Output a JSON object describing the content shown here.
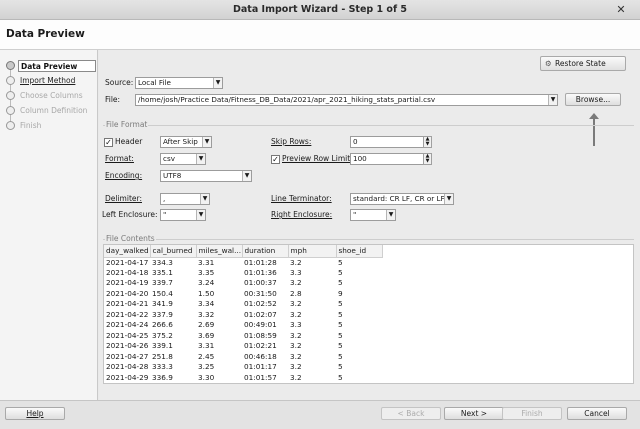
{
  "window": {
    "title": "Data Import Wizard - Step 1 of 5",
    "close_glyph": "✕"
  },
  "header": {
    "title": "Data Preview"
  },
  "steps": [
    {
      "label": "Data Preview",
      "state": "active"
    },
    {
      "label": "Import Method",
      "state": "link"
    },
    {
      "label": "Choose Columns",
      "state": "disabled"
    },
    {
      "label": "Column Definition",
      "state": "disabled"
    },
    {
      "label": "Finish",
      "state": "disabled"
    }
  ],
  "toolbar": {
    "restore_label": "Restore State",
    "restore_icon": "gear-icon"
  },
  "source": {
    "label": "Source:",
    "value": "Local File"
  },
  "file": {
    "label": "File:",
    "path": "/home/josh/Practice Data/Fitness_DB_Data/2021/apr_2021_hiking_stats_partial.csv",
    "browse_label": "Browse..."
  },
  "file_format": {
    "section_label": "File Format",
    "header_label": "Header",
    "header_checked": true,
    "header_value": "After Skip",
    "skip_rows_label": "Skip Rows:",
    "skip_rows_value": "0",
    "format_label": "Format:",
    "format_value": "csv",
    "preview_limit_label": "Preview Row Limit:",
    "preview_limit_checked": true,
    "preview_limit_value": "100",
    "encoding_label": "Encoding:",
    "encoding_value": "UTF8",
    "delimiter_label": "Delimiter:",
    "delimiter_value": ",",
    "line_terminator_label": "Line Terminator:",
    "line_terminator_value": "standard: CR LF, CR or LF",
    "left_enclosure_label": "Left Enclosure:",
    "left_enclosure_value": "\"",
    "right_enclosure_label": "Right Enclosure:",
    "right_enclosure_value": "\""
  },
  "file_contents": {
    "section_label": "File Contents",
    "columns": [
      "day_walked",
      "cal_burned",
      "miles_wal...",
      "duration",
      "mph",
      "shoe_id"
    ],
    "rows": [
      [
        "2021-04-17",
        "334.3",
        "3.31",
        "01:01:28",
        "3.2",
        "5"
      ],
      [
        "2021-04-18",
        "335.1",
        "3.35",
        "01:01:36",
        "3.3",
        "5"
      ],
      [
        "2021-04-19",
        "339.7",
        "3.24",
        "01:00:37",
        "3.2",
        "5"
      ],
      [
        "2021-04-20",
        "150.4",
        "1.50",
        "00:31:50",
        "2.8",
        "9"
      ],
      [
        "2021-04-21",
        "341.9",
        "3.34",
        "01:02:52",
        "3.2",
        "5"
      ],
      [
        "2021-04-22",
        "337.9",
        "3.32",
        "01:02:07",
        "3.2",
        "5"
      ],
      [
        "2021-04-24",
        "266.6",
        "2.69",
        "00:49:01",
        "3.3",
        "5"
      ],
      [
        "2021-04-25",
        "375.2",
        "3.69",
        "01:08:59",
        "3.2",
        "5"
      ],
      [
        "2021-04-26",
        "339.1",
        "3.31",
        "01:02:21",
        "3.2",
        "5"
      ],
      [
        "2021-04-27",
        "251.8",
        "2.45",
        "00:46:18",
        "3.2",
        "5"
      ],
      [
        "2021-04-28",
        "333.3",
        "3.25",
        "01:01:17",
        "3.2",
        "5"
      ],
      [
        "2021-04-29",
        "336.9",
        "3.30",
        "01:01:57",
        "3.2",
        "5"
      ]
    ]
  },
  "footer": {
    "help_label": "Help",
    "back_label": "< Back",
    "next_label": "Next >",
    "finish_label": "Finish",
    "cancel_label": "Cancel"
  }
}
